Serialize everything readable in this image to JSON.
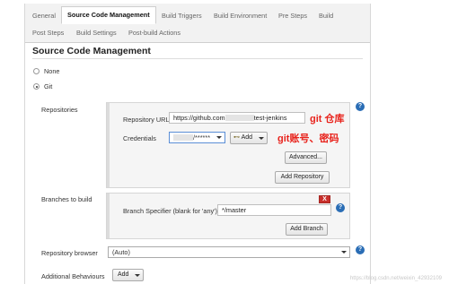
{
  "tabs": {
    "row1": [
      "General",
      "Source Code Management",
      "Build Triggers",
      "Build Environment",
      "Pre Steps",
      "Build"
    ],
    "row2": [
      "Post Steps",
      "Build Settings",
      "Post-build Actions"
    ]
  },
  "section": {
    "title": "Source Code Management"
  },
  "scm_options": {
    "none": "None",
    "git": "Git",
    "selected": "Git"
  },
  "repositories": {
    "label": "Repositories",
    "url_label": "Repository URL",
    "url_prefix": "https://github.com",
    "url_suffix": "test-jenkins",
    "credentials_label": "Credentials",
    "credentials_value": "/******",
    "add_label": "Add",
    "advanced_label": "Advanced...",
    "add_repository_label": "Add Repository"
  },
  "branches": {
    "label": "Branches to build",
    "x_label": "X",
    "specifier_label": "Branch Specifier (blank for 'any')",
    "specifier_value": "*/master",
    "add_branch_label": "Add Branch"
  },
  "repo_browser": {
    "label": "Repository browser",
    "value": "(Auto)"
  },
  "additional": {
    "label": "Additional Behaviours",
    "add_label": "Add"
  },
  "annotations": {
    "git_repo": "git 仓库",
    "git_account": "git账号、密码"
  },
  "watermark": "https://blog.csdn.net/weixin_42932109",
  "icons": {
    "help": "help-icon",
    "caret": "caret-down-icon",
    "key": "key-icon"
  },
  "colors": {
    "help": "#2a6db5",
    "annotation": "#e8231c",
    "delete": "#c9302c"
  }
}
